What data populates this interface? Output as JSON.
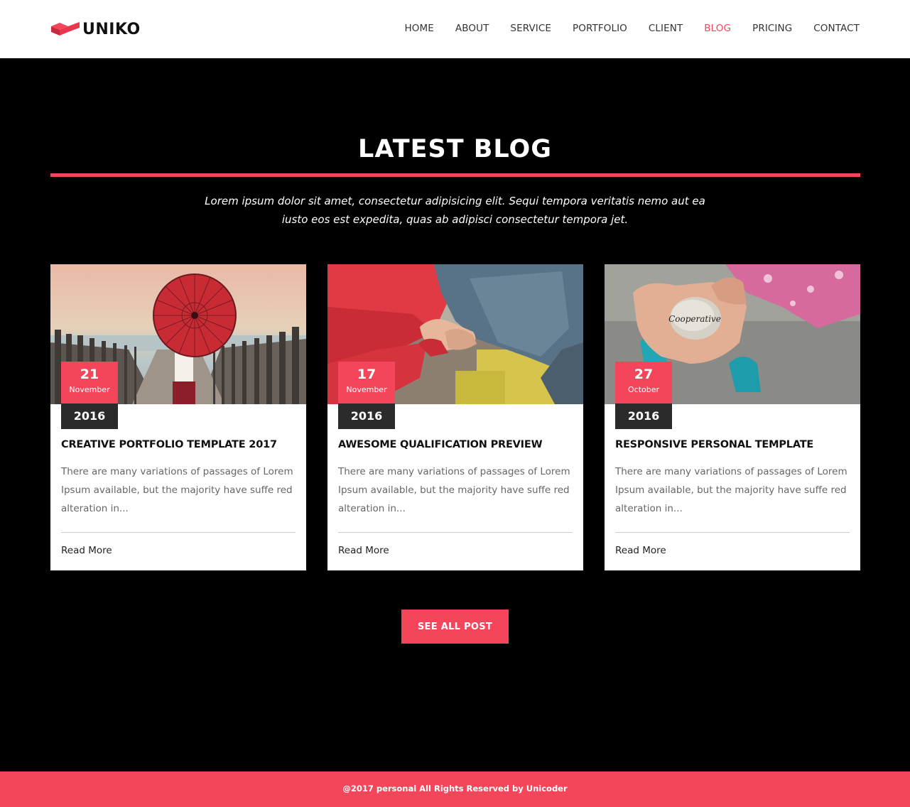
{
  "brand": {
    "name": "UNIKO",
    "accent_color": "#f5455b"
  },
  "nav": {
    "items": [
      {
        "label": "HOME",
        "active": false
      },
      {
        "label": "ABOUT",
        "active": false
      },
      {
        "label": "SERVICE",
        "active": false
      },
      {
        "label": "PORTFOLIO",
        "active": false
      },
      {
        "label": "CLIENT",
        "active": false
      },
      {
        "label": "BLOG",
        "active": true
      },
      {
        "label": "PRICING",
        "active": false
      },
      {
        "label": "CONTACT",
        "active": false
      }
    ]
  },
  "section": {
    "title": "LATEST BLOG",
    "description": "Lorem ipsum dolor sit amet, consectetur adipisicing elit. Sequi tempora veritatis nemo aut ea iusto eos est expedita, quas ab adipisci consectetur tempora jet."
  },
  "posts": [
    {
      "image": "woman-with-red-umbrella-photo",
      "day": "21",
      "month": "November",
      "year": "2016",
      "title": "CREATIVE PORTFOLIO TEMPLATE 2017",
      "excerpt": "There are many variations of passages of Lorem Ipsum available, but the majority have suffe red alteration in...",
      "read_more": "Read More"
    },
    {
      "image": "handshake-photo",
      "day": "17",
      "month": "November",
      "year": "2016",
      "title": "AWESOME QUALIFICATION PREVIEW",
      "excerpt": "There are many variations of passages of Lorem Ipsum available, but the majority have suffe red alteration in...",
      "read_more": "Read More"
    },
    {
      "image": "hand-holding-cooperative-stone-photo",
      "stone_text": "Cooperative",
      "day": "27",
      "month": "October",
      "year": "2016",
      "title": "RESPONSIVE PERSONAL TEMPLATE",
      "excerpt": "There are many variations of passages of Lorem Ipsum available, but the majority have suffe red alteration in...",
      "read_more": "Read More"
    }
  ],
  "see_all_label": "SEE ALL POST",
  "footer": {
    "text": "@2017 personal All Rights Reserved by Unicoder"
  }
}
